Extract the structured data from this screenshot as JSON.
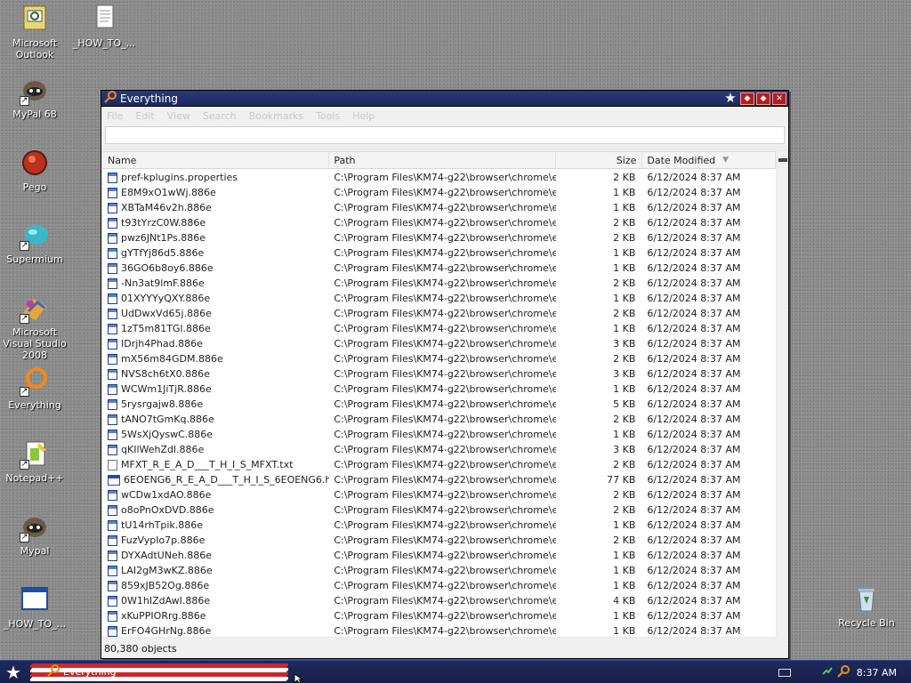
{
  "desktop": {
    "icons": [
      {
        "label": "Microsoft Outlook",
        "icon": "outlook-icon"
      },
      {
        "label": "_HOW_TO_...",
        "icon": "text-file-icon"
      },
      {
        "label": "MyPal 68",
        "icon": "mypal-icon"
      },
      {
        "label": "Pego",
        "icon": "pego-icon"
      },
      {
        "label": "Supermium",
        "icon": "supermium-icon"
      },
      {
        "label": "Microsoft Visual Studio 2008",
        "icon": "visual-studio-icon"
      },
      {
        "label": "Everything",
        "icon": "everything-icon"
      },
      {
        "label": "Notepad++",
        "icon": "notepadpp-icon"
      },
      {
        "label": "Mypal",
        "icon": "mypal-icon"
      },
      {
        "label": "_HOW_TO_...",
        "icon": "hta-file-icon"
      },
      {
        "label": "Recycle Bin",
        "icon": "recycle-bin-icon"
      }
    ]
  },
  "window": {
    "title": "Everything",
    "menu": [
      "File",
      "Edit",
      "View",
      "Search",
      "Bookmarks",
      "Tools",
      "Help"
    ],
    "search": {
      "value": "",
      "placeholder": ""
    },
    "columns": {
      "name": "Name",
      "path": "Path",
      "size": "Size",
      "date": "Date Modified"
    },
    "rows": [
      {
        "name": "pref-kplugins.properties",
        "path": "C:\\Program Files\\KM74-g22\\browser\\chrome\\en-...",
        "size": "2 KB",
        "date": "6/12/2024 8:37 AM",
        "type": "file"
      },
      {
        "name": "E8M9xO1wWj.886e",
        "path": "C:\\Program Files\\KM74-g22\\browser\\chrome\\en-...",
        "size": "1 KB",
        "date": "6/12/2024 8:37 AM",
        "type": "file"
      },
      {
        "name": "XBTaM46v2h.886e",
        "path": "C:\\Program Files\\KM74-g22\\browser\\chrome\\en-...",
        "size": "1 KB",
        "date": "6/12/2024 8:37 AM",
        "type": "file"
      },
      {
        "name": "t93tYrzC0W.886e",
        "path": "C:\\Program Files\\KM74-g22\\browser\\chrome\\en-...",
        "size": "2 KB",
        "date": "6/12/2024 8:37 AM",
        "type": "file"
      },
      {
        "name": "pwz6JNt1Ps.886e",
        "path": "C:\\Program Files\\KM74-g22\\browser\\chrome\\en-...",
        "size": "2 KB",
        "date": "6/12/2024 8:37 AM",
        "type": "file"
      },
      {
        "name": "gYTfYj86d5.886e",
        "path": "C:\\Program Files\\KM74-g22\\browser\\chrome\\en-...",
        "size": "1 KB",
        "date": "6/12/2024 8:37 AM",
        "type": "file"
      },
      {
        "name": "36GO6b8oy6.886e",
        "path": "C:\\Program Files\\KM74-g22\\browser\\chrome\\en-...",
        "size": "1 KB",
        "date": "6/12/2024 8:37 AM",
        "type": "file"
      },
      {
        "name": "-Nn3at9lmF.886e",
        "path": "C:\\Program Files\\KM74-g22\\browser\\chrome\\en-...",
        "size": "2 KB",
        "date": "6/12/2024 8:37 AM",
        "type": "file"
      },
      {
        "name": "01XYYYyQXY.886e",
        "path": "C:\\Program Files\\KM74-g22\\browser\\chrome\\en-...",
        "size": "1 KB",
        "date": "6/12/2024 8:37 AM",
        "type": "file"
      },
      {
        "name": "UdDwxVd65j.886e",
        "path": "C:\\Program Files\\KM74-g22\\browser\\chrome\\en-...",
        "size": "2 KB",
        "date": "6/12/2024 8:37 AM",
        "type": "file"
      },
      {
        "name": "1zT5m81TGl.886e",
        "path": "C:\\Program Files\\KM74-g22\\browser\\chrome\\en-...",
        "size": "1 KB",
        "date": "6/12/2024 8:37 AM",
        "type": "file"
      },
      {
        "name": "IDrjh4Phad.886e",
        "path": "C:\\Program Files\\KM74-g22\\browser\\chrome\\en-...",
        "size": "3 KB",
        "date": "6/12/2024 8:37 AM",
        "type": "file"
      },
      {
        "name": "mX56m84GDM.886e",
        "path": "C:\\Program Files\\KM74-g22\\browser\\chrome\\en-...",
        "size": "2 KB",
        "date": "6/12/2024 8:37 AM",
        "type": "file"
      },
      {
        "name": "NVS8ch6tX0.886e",
        "path": "C:\\Program Files\\KM74-g22\\browser\\chrome\\en-...",
        "size": "3 KB",
        "date": "6/12/2024 8:37 AM",
        "type": "file"
      },
      {
        "name": "WCWm1JiTjR.886e",
        "path": "C:\\Program Files\\KM74-g22\\browser\\chrome\\en-...",
        "size": "1 KB",
        "date": "6/12/2024 8:37 AM",
        "type": "file"
      },
      {
        "name": "5rysrgajw8.886e",
        "path": "C:\\Program Files\\KM74-g22\\browser\\chrome\\en-...",
        "size": "5 KB",
        "date": "6/12/2024 8:37 AM",
        "type": "file"
      },
      {
        "name": "tANO7tGmKq.886e",
        "path": "C:\\Program Files\\KM74-g22\\browser\\chrome\\en-...",
        "size": "2 KB",
        "date": "6/12/2024 8:37 AM",
        "type": "file"
      },
      {
        "name": "5WsXjQyswC.886e",
        "path": "C:\\Program Files\\KM74-g22\\browser\\chrome\\en-...",
        "size": "1 KB",
        "date": "6/12/2024 8:37 AM",
        "type": "file"
      },
      {
        "name": "qKIlWehZdl.886e",
        "path": "C:\\Program Files\\KM74-g22\\browser\\chrome\\en-...",
        "size": "3 KB",
        "date": "6/12/2024 8:37 AM",
        "type": "file"
      },
      {
        "name": "MFXT_R_E_A_D___T_H_I_S_MFXT.txt",
        "path": "C:\\Program Files\\KM74-g22\\browser\\chrome\\en-...",
        "size": "2 KB",
        "date": "6/12/2024 8:37 AM",
        "type": "txt"
      },
      {
        "name": "6EOENG6_R_E_A_D___T_H_I_S_6EOENG6.hta",
        "path": "C:\\Program Files\\KM74-g22\\browser\\chrome\\en-...",
        "size": "77 KB",
        "date": "6/12/2024 8:37 AM",
        "type": "hta"
      },
      {
        "name": "wCDw1xdAO.886e",
        "path": "C:\\Program Files\\KM74-g22\\browser\\chrome\\en-...",
        "size": "2 KB",
        "date": "6/12/2024 8:37 AM",
        "type": "file"
      },
      {
        "name": "o8oPnOxDVD.886e",
        "path": "C:\\Program Files\\KM74-g22\\browser\\chrome\\en-...",
        "size": "2 KB",
        "date": "6/12/2024 8:37 AM",
        "type": "file"
      },
      {
        "name": "tU14rhTpik.886e",
        "path": "C:\\Program Files\\KM74-g22\\browser\\chrome\\en-...",
        "size": "1 KB",
        "date": "6/12/2024 8:37 AM",
        "type": "file"
      },
      {
        "name": "FuzVypIo7p.886e",
        "path": "C:\\Program Files\\KM74-g22\\browser\\chrome\\en-...",
        "size": "2 KB",
        "date": "6/12/2024 8:37 AM",
        "type": "file"
      },
      {
        "name": "DYXAdtUNeh.886e",
        "path": "C:\\Program Files\\KM74-g22\\browser\\chrome\\en-...",
        "size": "1 KB",
        "date": "6/12/2024 8:37 AM",
        "type": "file"
      },
      {
        "name": "LAI2gM3wKZ.886e",
        "path": "C:\\Program Files\\KM74-g22\\browser\\chrome\\en-...",
        "size": "1 KB",
        "date": "6/12/2024 8:37 AM",
        "type": "file"
      },
      {
        "name": "859xJB52Og.886e",
        "path": "C:\\Program Files\\KM74-g22\\browser\\chrome\\en-...",
        "size": "1 KB",
        "date": "6/12/2024 8:37 AM",
        "type": "file"
      },
      {
        "name": "0W1hIZdAwI.886e",
        "path": "C:\\Program Files\\KM74-g22\\browser\\chrome\\en-...",
        "size": "4 KB",
        "date": "6/12/2024 8:37 AM",
        "type": "file"
      },
      {
        "name": "xKuPPIORrg.886e",
        "path": "C:\\Program Files\\KM74-g22\\browser\\chrome\\en-...",
        "size": "1 KB",
        "date": "6/12/2024 8:37 AM",
        "type": "file"
      },
      {
        "name": "ErFO4GHrNg.886e",
        "path": "C:\\Program Files\\KM74-g22\\browser\\chrome\\en-...",
        "size": "1 KB",
        "date": "6/12/2024 8:37 AM",
        "type": "file"
      }
    ],
    "status": "80,380 objects"
  },
  "taskbar": {
    "task_label": "Everything",
    "clock": "8:37 AM"
  },
  "colors": {
    "titlebar": "#1b2860",
    "close_button": "#b21f1f",
    "taskbar": "#162049"
  }
}
